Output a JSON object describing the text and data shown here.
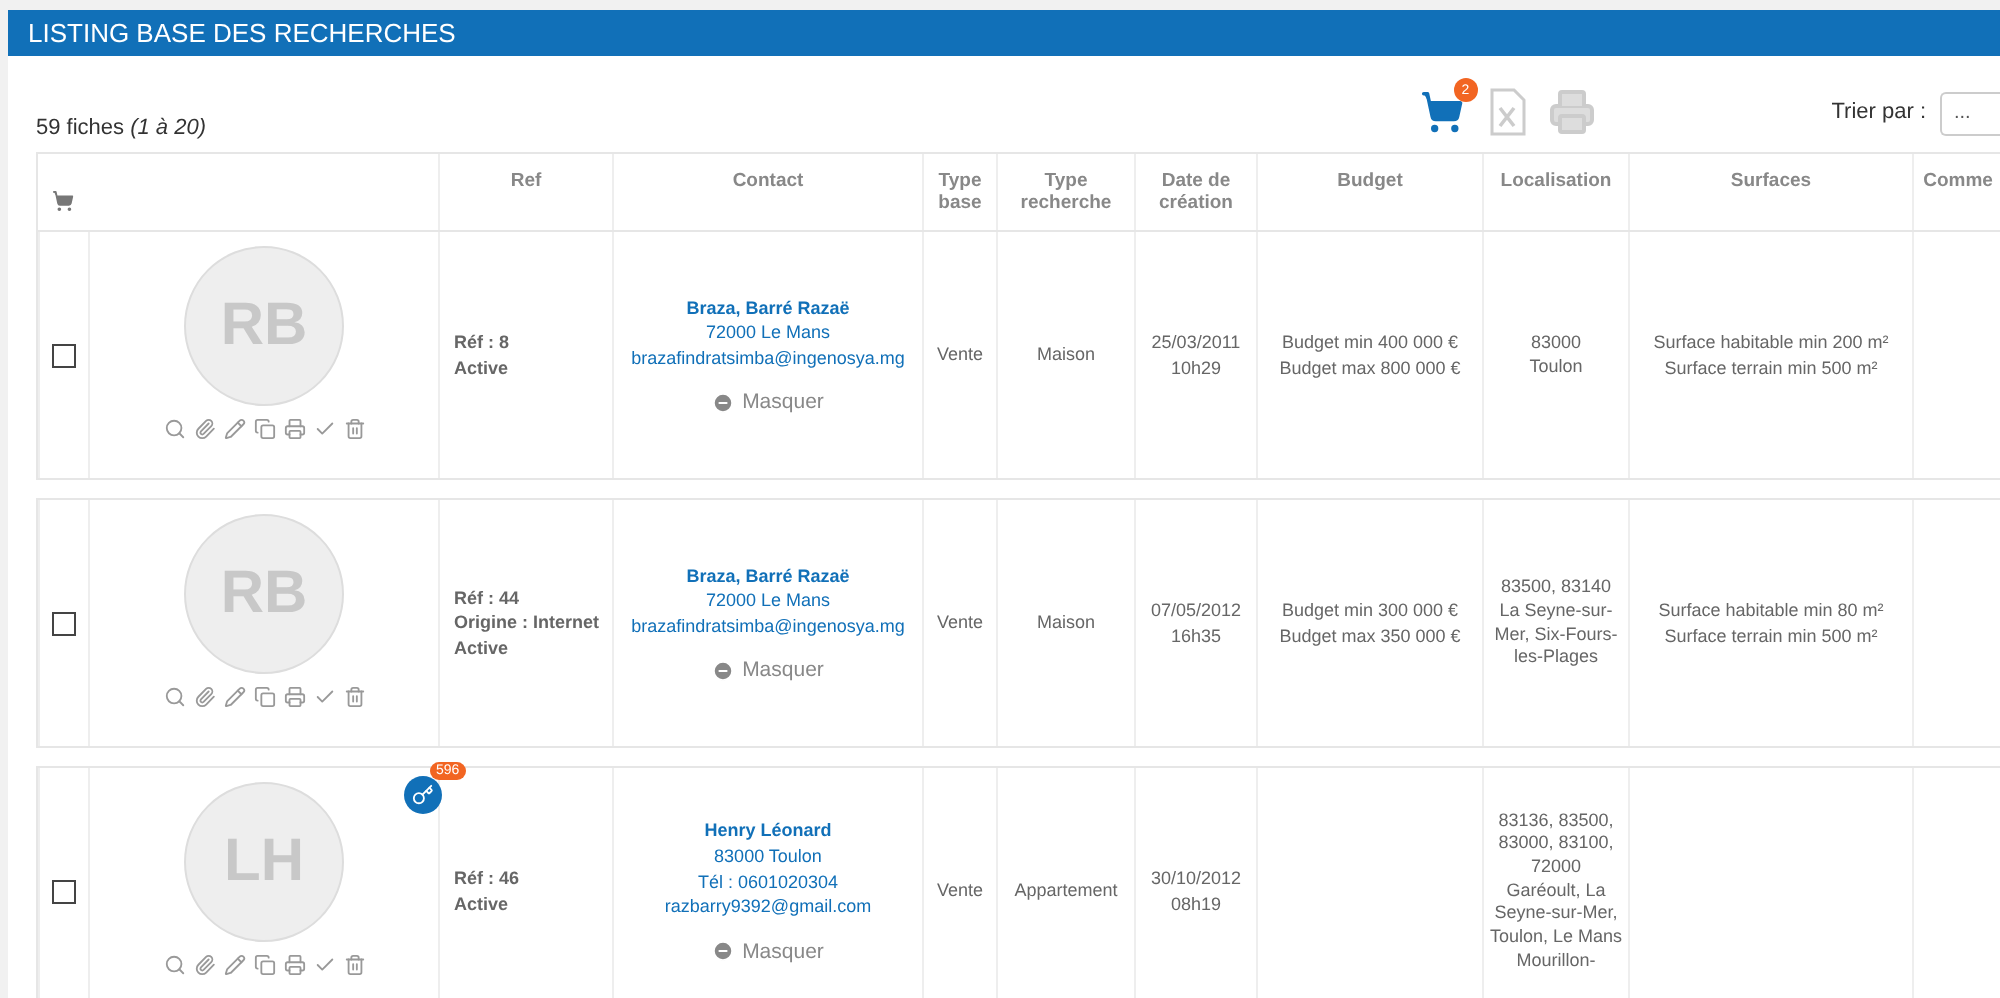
{
  "header": {
    "title": "LISTING BASE DES RECHERCHES"
  },
  "summary": {
    "count": "59 fiches",
    "range": "(1 à 20)"
  },
  "toolbar": {
    "cart_badge": "2",
    "sort_label": "Trier par :",
    "sort_value": "..."
  },
  "columns": [
    "Ref",
    "Contact",
    "Type base",
    "Type recherche",
    "Date de création",
    "Budget",
    "Localisation",
    "Surfaces",
    "Comme"
  ],
  "rows": [
    {
      "checked": false,
      "initials": "RB",
      "ref": [
        "Réf : 8",
        "Active"
      ],
      "contact_name": "Braza, Barré Razaë",
      "contact_lines": [
        "72000 Le Mans",
        "brazafindratsimba@ingenosya.mg"
      ],
      "hide_label": "Masquer",
      "type_base": "Vente",
      "type_recherche": "Maison",
      "date": [
        "25/03/2011",
        "10h29"
      ],
      "budget": [
        "Budget min 400 000 €",
        "Budget max 800 000 €"
      ],
      "localisation": [
        "83000",
        "Toulon"
      ],
      "surfaces": [
        "Surface habitable min 200 m²",
        "Surface terrain min 500 m²"
      ]
    },
    {
      "checked": false,
      "initials": "RB",
      "ref": [
        "Réf : 44",
        "Origine : Internet",
        "Active"
      ],
      "contact_name": "Braza, Barré Razaë",
      "contact_lines": [
        "72000 Le Mans",
        "brazafindratsimba@ingenosya.mg"
      ],
      "hide_label": "Masquer",
      "type_base": "Vente",
      "type_recherche": "Maison",
      "date": [
        "07/05/2012",
        "16h35"
      ],
      "budget": [
        "Budget min 300 000 €",
        "Budget max 350 000 €"
      ],
      "localisation": [
        "83500, 83140",
        "La Seyne-sur-Mer, Six-Fours-les-Plages"
      ],
      "surfaces": [
        "Surface habitable min 80 m²",
        "Surface terrain min 500 m²"
      ]
    },
    {
      "checked": false,
      "initials": "LH",
      "keys_badge": "596",
      "ref": [
        "Réf : 46",
        "Active"
      ],
      "contact_name": "Henry Léonard",
      "contact_lines": [
        "83000 Toulon",
        "Tél : 0601020304",
        "razbarry9392@gmail.com"
      ],
      "hide_label": "Masquer",
      "type_base": "Vente",
      "type_recherche": "Appartement",
      "date": [
        "30/10/2012",
        "08h19"
      ],
      "localisation": [
        "83136, 83500, 83000, 83100, 72000",
        "Garéoult, La Seyne-sur-Mer, Toulon, Le Mans Mourillon-"
      ]
    }
  ]
}
